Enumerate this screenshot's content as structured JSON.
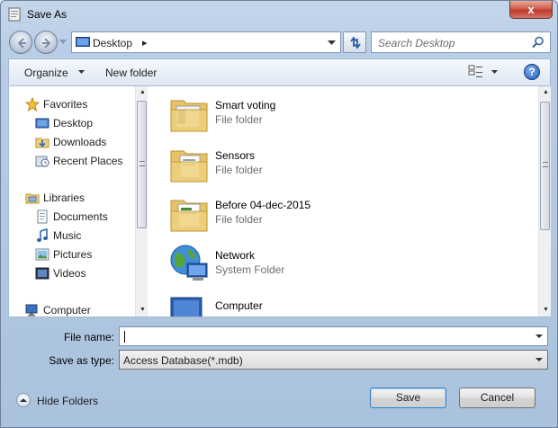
{
  "window": {
    "title": "Save As",
    "close_glyph": "x"
  },
  "address": {
    "location": "Desktop",
    "separator": "▸"
  },
  "search": {
    "placeholder": "Search Desktop"
  },
  "toolbar": {
    "organize_label": "Organize",
    "new_folder_label": "New folder",
    "help_glyph": "?"
  },
  "nav_tree": {
    "items": [
      {
        "label": "Favorites",
        "icon": "star-icon"
      },
      {
        "label": "Desktop",
        "icon": "desktop-icon"
      },
      {
        "label": "Downloads",
        "icon": "downloads-icon"
      },
      {
        "label": "Recent Places",
        "icon": "recent-places-icon"
      },
      {
        "label": "Libraries",
        "icon": "libraries-icon"
      },
      {
        "label": "Documents",
        "icon": "documents-icon"
      },
      {
        "label": "Music",
        "icon": "music-icon"
      },
      {
        "label": "Pictures",
        "icon": "pictures-icon"
      },
      {
        "label": "Videos",
        "icon": "videos-icon"
      },
      {
        "label": "Computer",
        "icon": "computer-icon"
      }
    ]
  },
  "files": [
    {
      "name": "Smart voting",
      "type": "File folder",
      "icon": "folder-icon"
    },
    {
      "name": "Sensors",
      "type": "File folder",
      "icon": "folder-icon"
    },
    {
      "name": "Before 04-dec-2015",
      "type": "File folder",
      "icon": "folder-icon"
    },
    {
      "name": "Network",
      "type": "System Folder",
      "icon": "network-icon"
    },
    {
      "name": "Computer",
      "type": "",
      "icon": "computer-icon"
    }
  ],
  "form": {
    "file_name_label": "File name:",
    "file_name_value": "",
    "save_type_label": "Save as type:",
    "save_type_value": "Access Database(*.mdb)"
  },
  "footer": {
    "hide_folders_label": "Hide Folders",
    "save_label": "Save",
    "cancel_label": "Cancel"
  }
}
